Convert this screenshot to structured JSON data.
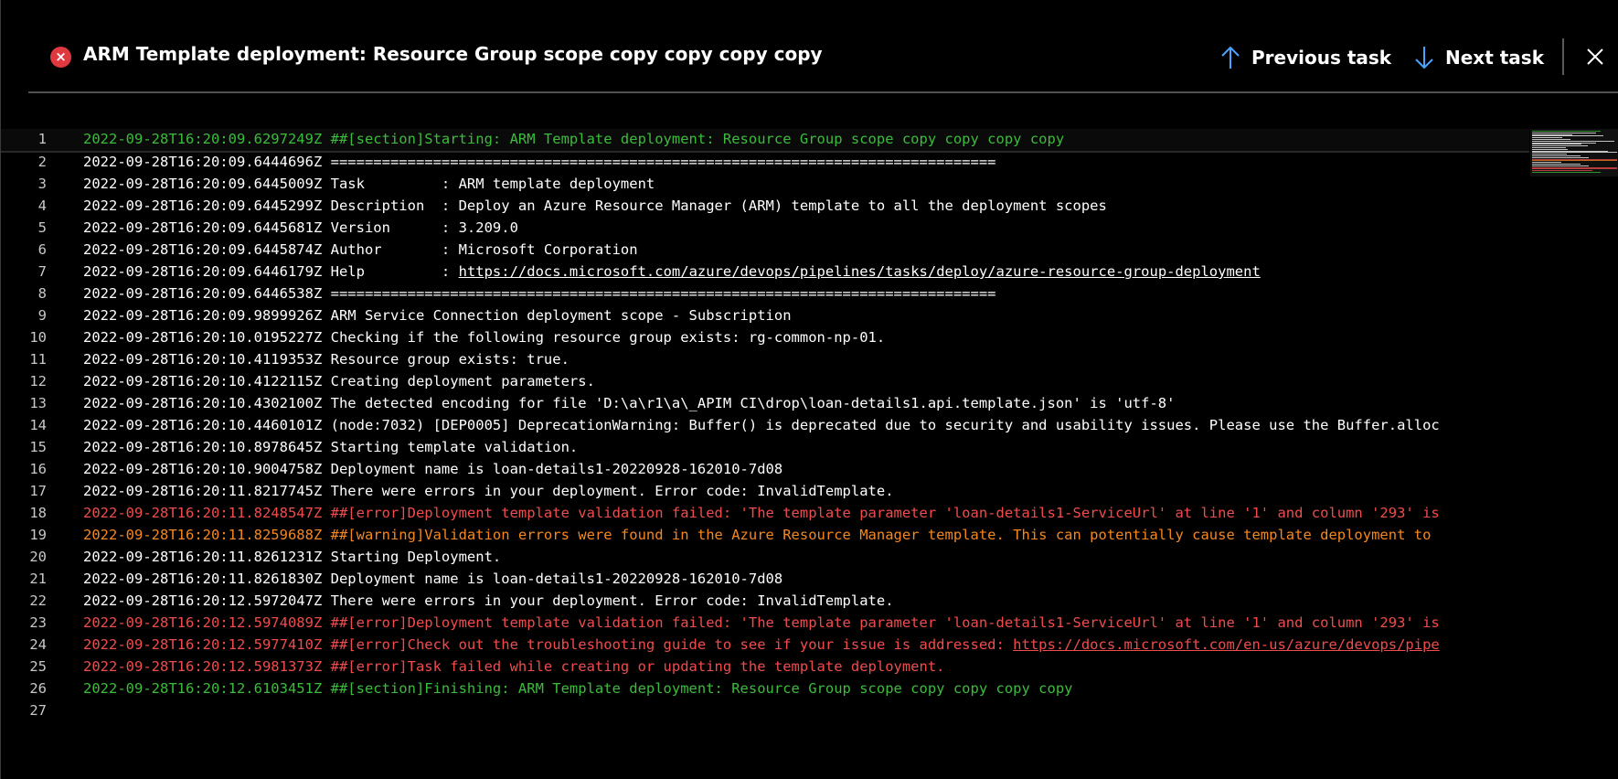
{
  "header": {
    "title": "ARM Template deployment: Resource Group scope copy copy copy copy",
    "previous_label": "Previous task",
    "next_label": "Next task",
    "status_icon": "error-circle-icon",
    "status_color": "#e0383f"
  },
  "colors": {
    "normal": "#ffffff",
    "section": "#3bbc3b",
    "error": "#f14c4c",
    "warning": "#f5871f",
    "nav_arrow": "#4aa3ff"
  },
  "log_lines": [
    {
      "num": "1",
      "type": "section",
      "text": "2022-09-28T16:20:09.6297249Z ##[section]Starting: ARM Template deployment: Resource Group scope copy copy copy copy"
    },
    {
      "num": "2",
      "type": "normal",
      "text": "2022-09-28T16:20:09.6444696Z =============================================================================="
    },
    {
      "num": "3",
      "type": "normal",
      "text": "2022-09-28T16:20:09.6445009Z Task         : ARM template deployment"
    },
    {
      "num": "4",
      "type": "normal",
      "text": "2022-09-28T16:20:09.6445299Z Description  : Deploy an Azure Resource Manager (ARM) template to all the deployment scopes"
    },
    {
      "num": "5",
      "type": "normal",
      "text": "2022-09-28T16:20:09.6445681Z Version      : 3.209.0"
    },
    {
      "num": "6",
      "type": "normal",
      "text": "2022-09-28T16:20:09.6445874Z Author       : Microsoft Corporation"
    },
    {
      "num": "7",
      "type": "normal",
      "prefix": "2022-09-28T16:20:09.6446179Z Help         : ",
      "link": "https://docs.microsoft.com/azure/devops/pipelines/tasks/deploy/azure-resource-group-deployment"
    },
    {
      "num": "8",
      "type": "normal",
      "text": "2022-09-28T16:20:09.6446538Z =============================================================================="
    },
    {
      "num": "9",
      "type": "normal",
      "text": "2022-09-28T16:20:09.9899926Z ARM Service Connection deployment scope - Subscription"
    },
    {
      "num": "10",
      "type": "normal",
      "text": "2022-09-28T16:20:10.0195227Z Checking if the following resource group exists: rg-common-np-01."
    },
    {
      "num": "11",
      "type": "normal",
      "text": "2022-09-28T16:20:10.4119353Z Resource group exists: true."
    },
    {
      "num": "12",
      "type": "normal",
      "text": "2022-09-28T16:20:10.4122115Z Creating deployment parameters."
    },
    {
      "num": "13",
      "type": "normal",
      "text": "2022-09-28T16:20:10.4302100Z The detected encoding for file 'D:\\a\\r1\\a\\_APIM CI\\drop\\loan-details1.api.template.json' is 'utf-8'"
    },
    {
      "num": "14",
      "type": "normal",
      "text": "2022-09-28T16:20:10.4460101Z (node:7032) [DEP0005] DeprecationWarning: Buffer() is deprecated due to security and usability issues. Please use the Buffer.alloc"
    },
    {
      "num": "15",
      "type": "normal",
      "text": "2022-09-28T16:20:10.8978645Z Starting template validation."
    },
    {
      "num": "16",
      "type": "normal",
      "text": "2022-09-28T16:20:10.9004758Z Deployment name is loan-details1-20220928-162010-7d08"
    },
    {
      "num": "17",
      "type": "normal",
      "text": "2022-09-28T16:20:11.8217745Z There were errors in your deployment. Error code: InvalidTemplate."
    },
    {
      "num": "18",
      "type": "error",
      "text": "2022-09-28T16:20:11.8248547Z ##[error]Deployment template validation failed: 'The template parameter 'loan-details1-ServiceUrl' at line '1' and column '293' is"
    },
    {
      "num": "19",
      "type": "warning",
      "text": "2022-09-28T16:20:11.8259688Z ##[warning]Validation errors were found in the Azure Resource Manager template. This can potentially cause template deployment to"
    },
    {
      "num": "20",
      "type": "normal",
      "text": "2022-09-28T16:20:11.8261231Z Starting Deployment."
    },
    {
      "num": "21",
      "type": "normal",
      "text": "2022-09-28T16:20:11.8261830Z Deployment name is loan-details1-20220928-162010-7d08"
    },
    {
      "num": "22",
      "type": "normal",
      "text": "2022-09-28T16:20:12.5972047Z There were errors in your deployment. Error code: InvalidTemplate."
    },
    {
      "num": "23",
      "type": "error",
      "text": "2022-09-28T16:20:12.5974089Z ##[error]Deployment template validation failed: 'The template parameter 'loan-details1-ServiceUrl' at line '1' and column '293' is"
    },
    {
      "num": "24",
      "type": "error",
      "prefix": "2022-09-28T16:20:12.5977410Z ##[error]Check out the troubleshooting guide to see if your issue is addressed: ",
      "link": "https://docs.microsoft.com/en-us/azure/devops/pipe"
    },
    {
      "num": "25",
      "type": "error",
      "text": "2022-09-28T16:20:12.5981373Z ##[error]Task failed while creating or updating the template deployment."
    },
    {
      "num": "26",
      "type": "section",
      "text": "2022-09-28T16:20:12.6103451Z ##[section]Finishing: ARM Template deployment: Resource Group scope copy copy copy copy"
    },
    {
      "num": "27",
      "type": "normal",
      "text": ""
    }
  ]
}
